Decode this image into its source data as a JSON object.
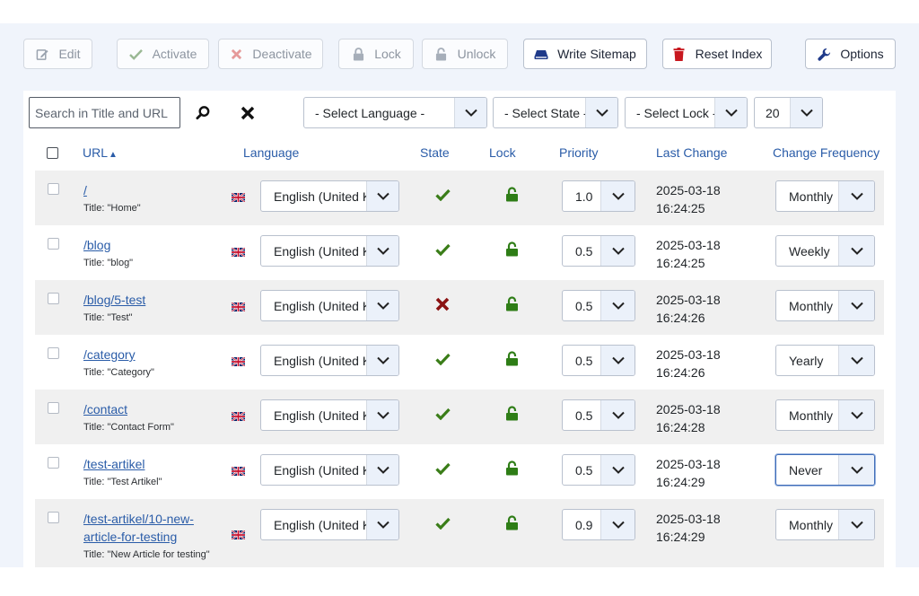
{
  "toolbar": {
    "edit": "Edit",
    "activate": "Activate",
    "deactivate": "Deactivate",
    "lock": "Lock",
    "unlock": "Unlock",
    "write_sitemap": "Write Sitemap",
    "reset_index": "Reset Index",
    "options": "Options"
  },
  "filters": {
    "search_placeholder": "Search in Title and URL",
    "search_value": "",
    "language": "- Select Language -",
    "state": "- Select State -",
    "lock": "- Select Lock -",
    "limit": "20"
  },
  "columns": {
    "url": "URL",
    "language": "Language",
    "state": "State",
    "lock": "Lock",
    "priority": "Priority",
    "last_change": "Last Change",
    "change_frequency": "Change Frequency"
  },
  "rows": [
    {
      "url": "/",
      "url_line2": "",
      "title": "Title: \"Home\"",
      "language": "English (United Kingdom)",
      "state": "active",
      "lock": "unlocked",
      "priority": "1.0",
      "date": "2025-03-18",
      "time": "16:24:25",
      "frequency": "Monthly"
    },
    {
      "url": "/blog",
      "url_line2": "",
      "title": "Title: \"blog\"",
      "language": "English (United Kingdom)",
      "state": "active",
      "lock": "unlocked",
      "priority": "0.5",
      "date": "2025-03-18",
      "time": "16:24:25",
      "frequency": "Weekly"
    },
    {
      "url": "/blog/5-test",
      "url_line2": "",
      "title": "Title: \"Test\"",
      "language": "English (United Kingdom)",
      "state": "inactive",
      "lock": "unlocked",
      "priority": "0.5",
      "date": "2025-03-18",
      "time": "16:24:26",
      "frequency": "Monthly"
    },
    {
      "url": "/category",
      "url_line2": "",
      "title": "Title: \"Category\"",
      "language": "English (United Kingdom)",
      "state": "active",
      "lock": "unlocked",
      "priority": "0.5",
      "date": "2025-03-18",
      "time": "16:24:26",
      "frequency": "Yearly"
    },
    {
      "url": "/contact",
      "url_line2": "",
      "title": "Title: \"Contact Form\"",
      "language": "English (United Kingdom)",
      "state": "active",
      "lock": "unlocked",
      "priority": "0.5",
      "date": "2025-03-18",
      "time": "16:24:28",
      "frequency": "Monthly"
    },
    {
      "url": "/test-artikel",
      "url_line2": "",
      "title": "Title: \"Test Artikel\"",
      "language": "English (United Kingdom)",
      "state": "active",
      "lock": "unlocked",
      "priority": "0.5",
      "date": "2025-03-18",
      "time": "16:24:29",
      "frequency": "Never"
    },
    {
      "url": "/test-artikel/10-new-",
      "url_line2": "article-for-testing",
      "title": "Title: \"New Article for testing\"",
      "language": "English (United Kingdom)",
      "state": "active",
      "lock": "unlocked",
      "priority": "0.9",
      "date": "2025-03-18",
      "time": "16:24:29",
      "frequency": "Monthly"
    }
  ],
  "colors": {
    "link": "#2a5ca8",
    "check": "#3a7d18",
    "cross": "#8b1212",
    "lock": "#2e7d16",
    "reset_icon": "#c8181f"
  }
}
